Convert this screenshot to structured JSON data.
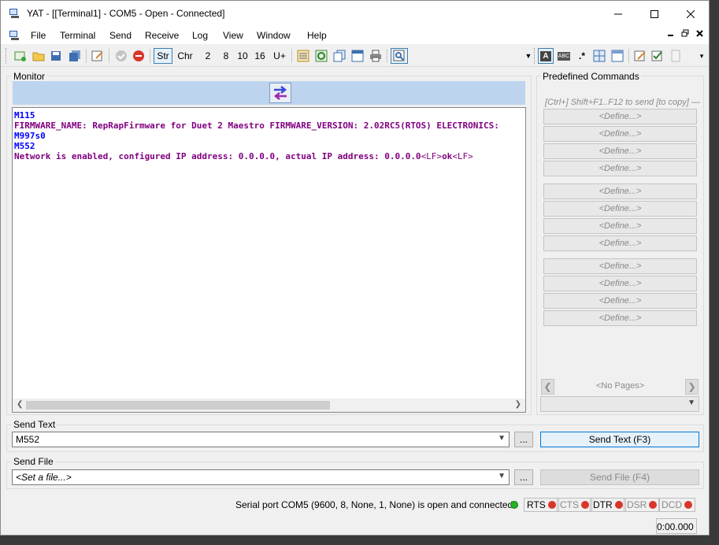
{
  "window": {
    "title": "YAT - [[Terminal1] - COM5 - Open - Connected]"
  },
  "menu": [
    "File",
    "Terminal",
    "Send",
    "Receive",
    "Log",
    "View",
    "Window",
    "Help"
  ],
  "toolbar": {
    "radix_buttons": [
      "Str",
      "Chr",
      "2",
      "8",
      "10",
      "16",
      "U+"
    ],
    "format_buttons": [
      "A",
      "ABC",
      ".*"
    ]
  },
  "monitor": {
    "label": "Monitor",
    "lines": [
      {
        "text": "M115",
        "kind": "tx"
      },
      {
        "text": "FIRMWARE_NAME: RepRapFirmware for Duet 2 Maestro FIRMWARE_VERSION: 2.02RC5(RTOS) ELECTRONICS:",
        "kind": "rx"
      },
      {
        "text": "M997s0",
        "kind": "tx"
      },
      {
        "text": "M552",
        "kind": "tx"
      },
      {
        "text": "Network is enabled, configured IP address: 0.0.0.0, actual IP address: 0.0.0.0",
        "kind": "rx",
        "suffix_ctl1": "<LF>",
        "suffix_text": "ok",
        "suffix_ctl2": "<LF>"
      }
    ]
  },
  "predefined": {
    "label": "Predefined Commands",
    "hint": "[Ctrl+] Shift+F1..F12 to send [to copy] —",
    "define_label": "<Define...>",
    "pages_label": "<No Pages>"
  },
  "send_text": {
    "label": "Send Text",
    "value": "M552",
    "more_button": "...",
    "send_button": "Send Text (F3)"
  },
  "send_file": {
    "label": "Send File",
    "value": "<Set a file...>",
    "more_button": "...",
    "send_button": "Send File (F4)"
  },
  "status": {
    "message": "Serial port COM5 (9600, 8, None, 1, None) is open and connected",
    "signals": [
      {
        "name": "RTS",
        "state": "red",
        "active": true
      },
      {
        "name": "CTS",
        "state": "red",
        "active": false
      },
      {
        "name": "DTR",
        "state": "red",
        "active": true
      },
      {
        "name": "DSR",
        "state": "red",
        "active": false
      },
      {
        "name": "DCD",
        "state": "red",
        "active": false
      }
    ],
    "connection_color": "#22b322",
    "elapsed": "0:00.000"
  },
  "colors": {
    "tx": "#0000ff",
    "rx": "#800080",
    "accent": "#0078d7",
    "monitor_header": "#bdd4ee"
  }
}
